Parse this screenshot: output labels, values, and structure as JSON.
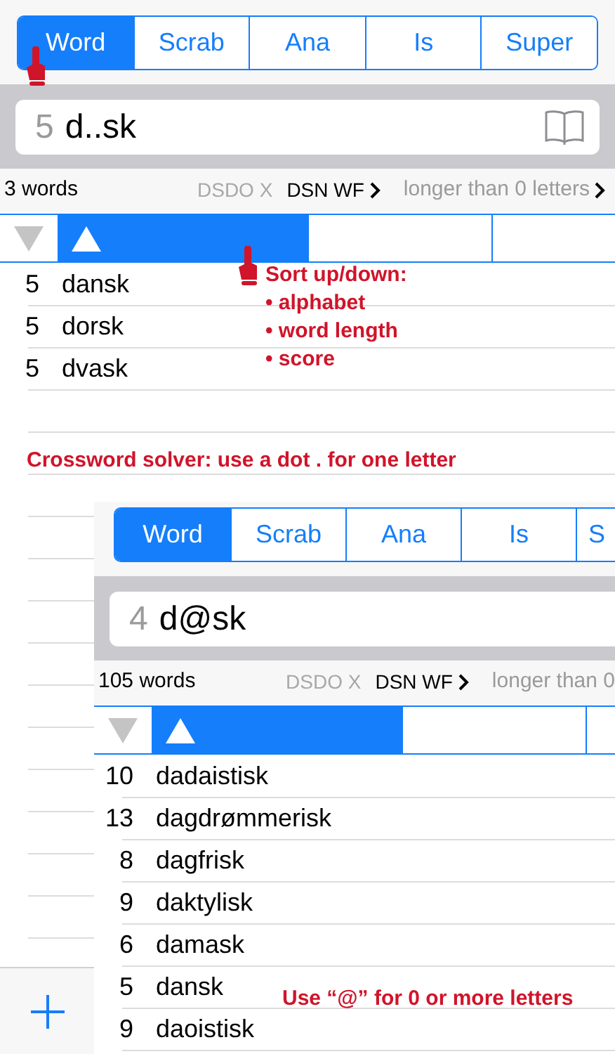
{
  "main_screen": {
    "tabs": [
      {
        "label": "Word",
        "selected": true
      },
      {
        "label": "Scrab",
        "selected": false
      },
      {
        "label": "Ana",
        "selected": false
      },
      {
        "label": "Is",
        "selected": false
      },
      {
        "label": "Super",
        "selected": false
      }
    ],
    "search": {
      "length": "5",
      "query": "d..sk"
    },
    "results_bar": {
      "count": "3 words",
      "dictionaries": [
        {
          "label": "DSDO X",
          "enabled": false
        },
        {
          "label": "DSN WF",
          "enabled": true
        }
      ],
      "length_filter": "longer than 0 letters"
    },
    "sort_header": [
      {
        "kind": "descending",
        "selected": false
      },
      {
        "kind": "ascending",
        "selected": true
      },
      {
        "kind": "blank",
        "selected": false
      },
      {
        "kind": "blank",
        "selected": false
      }
    ],
    "rows": [
      {
        "length": "5",
        "word": "dansk"
      },
      {
        "length": "5",
        "word": "dorsk"
      },
      {
        "length": "5",
        "word": "dvask"
      }
    ]
  },
  "sort_note": {
    "title": "Sort up/down:",
    "items": [
      "• alphabet",
      "• word length",
      "• score"
    ]
  },
  "dot_note": "Crossword solver: use a dot . for one letter",
  "inset_screen": {
    "tabs": [
      {
        "label": "Word",
        "selected": true
      },
      {
        "label": "Scrab",
        "selected": false
      },
      {
        "label": "Ana",
        "selected": false
      },
      {
        "label": "Is",
        "selected": false
      },
      {
        "label": "S",
        "selected": false
      }
    ],
    "search": {
      "length": "4",
      "query": "d@sk"
    },
    "results_bar": {
      "count": "105 words",
      "dictionaries": [
        {
          "label": "DSDO X",
          "enabled": false
        },
        {
          "label": "DSN WF",
          "enabled": true
        }
      ],
      "length_filter": "longer than 0"
    },
    "sort_header": [
      {
        "kind": "descending",
        "selected": false
      },
      {
        "kind": "ascending",
        "selected": true
      },
      {
        "kind": "blank",
        "selected": false
      },
      {
        "kind": "blank",
        "selected": false
      }
    ],
    "rows": [
      {
        "length": "10",
        "word": "dadaistisk"
      },
      {
        "length": "13",
        "word": "dagdrømmerisk"
      },
      {
        "length": "8",
        "word": "dagfrisk"
      },
      {
        "length": "9",
        "word": "daktylisk"
      },
      {
        "length": "6",
        "word": "damask"
      },
      {
        "length": "5",
        "word": "dansk"
      },
      {
        "length": "9",
        "word": "daoistisk"
      }
    ]
  },
  "at_note": "Use “@” for 0 or more letters"
}
